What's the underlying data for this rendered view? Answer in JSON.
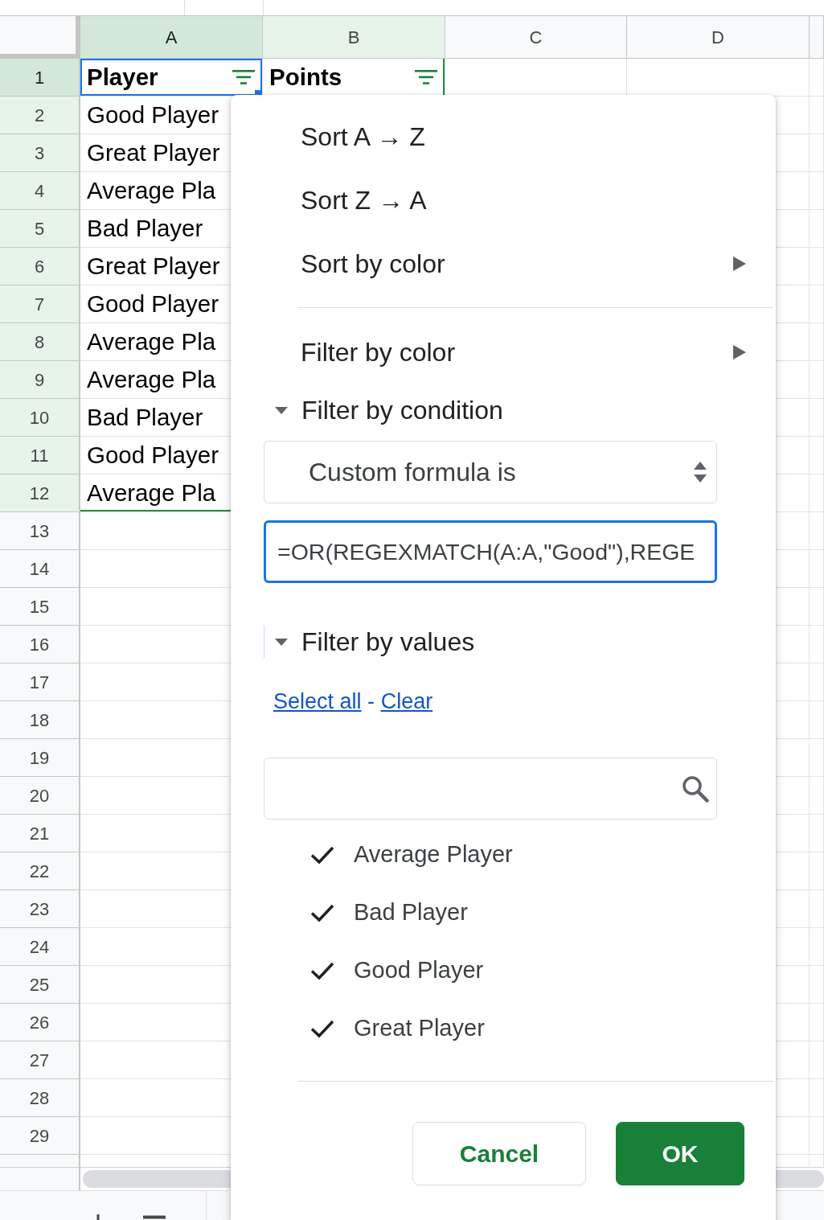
{
  "sheet": {
    "columns": [
      {
        "label": "A",
        "selected": true,
        "filtered": true
      },
      {
        "label": "B",
        "selected": false,
        "filtered": true
      },
      {
        "label": "C",
        "selected": false,
        "filtered": false
      },
      {
        "label": "D",
        "selected": false,
        "filtered": false
      }
    ],
    "rows": [
      {
        "number": "1",
        "selected": true,
        "filtered": true,
        "cells": [
          {
            "text": "Player",
            "bold": true,
            "selected": true,
            "filter_button": true
          },
          {
            "text": "Points",
            "bold": true,
            "selected": false,
            "filter_button": true
          }
        ]
      },
      {
        "number": "2",
        "selected": false,
        "filtered": true,
        "cells": [
          {
            "text": "Good Player",
            "bold": false,
            "selected": false,
            "filter_button": false
          }
        ]
      },
      {
        "number": "3",
        "selected": false,
        "filtered": true,
        "cells": [
          {
            "text": "Great Player",
            "bold": false,
            "selected": false,
            "filter_button": false
          }
        ]
      },
      {
        "number": "4",
        "selected": false,
        "filtered": true,
        "cells": [
          {
            "text": "Average Pla",
            "bold": false,
            "selected": false,
            "filter_button": false
          }
        ]
      },
      {
        "number": "5",
        "selected": false,
        "filtered": true,
        "cells": [
          {
            "text": "Bad Player",
            "bold": false,
            "selected": false,
            "filter_button": false
          }
        ]
      },
      {
        "number": "6",
        "selected": false,
        "filtered": true,
        "cells": [
          {
            "text": "Great Player",
            "bold": false,
            "selected": false,
            "filter_button": false
          }
        ]
      },
      {
        "number": "7",
        "selected": false,
        "filtered": true,
        "cells": [
          {
            "text": "Good Player",
            "bold": false,
            "selected": false,
            "filter_button": false
          }
        ]
      },
      {
        "number": "8",
        "selected": false,
        "filtered": true,
        "cells": [
          {
            "text": "Average Pla",
            "bold": false,
            "selected": false,
            "filter_button": false
          }
        ]
      },
      {
        "number": "9",
        "selected": false,
        "filtered": true,
        "cells": [
          {
            "text": "Average Pla",
            "bold": false,
            "selected": false,
            "filter_button": false
          }
        ]
      },
      {
        "number": "10",
        "selected": false,
        "filtered": true,
        "cells": [
          {
            "text": "Bad Player",
            "bold": false,
            "selected": false,
            "filter_button": false
          }
        ]
      },
      {
        "number": "11",
        "selected": false,
        "filtered": true,
        "cells": [
          {
            "text": "Good Player",
            "bold": false,
            "selected": false,
            "filter_button": false
          }
        ]
      },
      {
        "number": "12",
        "selected": false,
        "filtered": true,
        "cells": [
          {
            "text": "Average Pla",
            "bold": false,
            "selected": false,
            "filter_button": false
          }
        ]
      },
      {
        "number": "13",
        "selected": false,
        "filtered": false
      },
      {
        "number": "14",
        "selected": false,
        "filtered": false
      },
      {
        "number": "15",
        "selected": false,
        "filtered": false
      },
      {
        "number": "16",
        "selected": false,
        "filtered": false
      },
      {
        "number": "17",
        "selected": false,
        "filtered": false
      },
      {
        "number": "18",
        "selected": false,
        "filtered": false
      },
      {
        "number": "19",
        "selected": false,
        "filtered": false
      },
      {
        "number": "20",
        "selected": false,
        "filtered": false
      },
      {
        "number": "21",
        "selected": false,
        "filtered": false
      },
      {
        "number": "22",
        "selected": false,
        "filtered": false
      },
      {
        "number": "23",
        "selected": false,
        "filtered": false
      },
      {
        "number": "24",
        "selected": false,
        "filtered": false
      },
      {
        "number": "25",
        "selected": false,
        "filtered": false
      },
      {
        "number": "26",
        "selected": false,
        "filtered": false
      },
      {
        "number": "27",
        "selected": false,
        "filtered": false
      },
      {
        "number": "28",
        "selected": false,
        "filtered": false
      },
      {
        "number": "29",
        "selected": false,
        "filtered": false
      }
    ]
  },
  "filter_menu": {
    "sort_options": [
      {
        "label": "Sort A → Z",
        "submenu": false
      },
      {
        "label": "Sort Z → A",
        "submenu": false
      },
      {
        "label": "Sort by color",
        "submenu": true
      }
    ],
    "filter_by_color": {
      "label": "Filter by color",
      "submenu": true
    },
    "condition": {
      "label": "Filter by condition",
      "expanded": true,
      "focused": false,
      "operator": "Custom formula is",
      "formula": "=OR(REGEXMATCH(A:A,\"Good\"),REGE",
      "formula_focused": true
    },
    "values": {
      "label": "Filter by values",
      "expanded": true,
      "focused": true,
      "select_all": "Select all",
      "separator": "-",
      "clear": "Clear",
      "options": [
        {
          "label": "Average Player",
          "checked": true
        },
        {
          "label": "Bad Player",
          "checked": true
        },
        {
          "label": "Good Player",
          "checked": true
        },
        {
          "label": "Great Player",
          "checked": true
        }
      ]
    },
    "buttons": [
      {
        "label": "Cancel",
        "kind": "secondary"
      },
      {
        "label": "OK",
        "kind": "primary"
      }
    ]
  }
}
